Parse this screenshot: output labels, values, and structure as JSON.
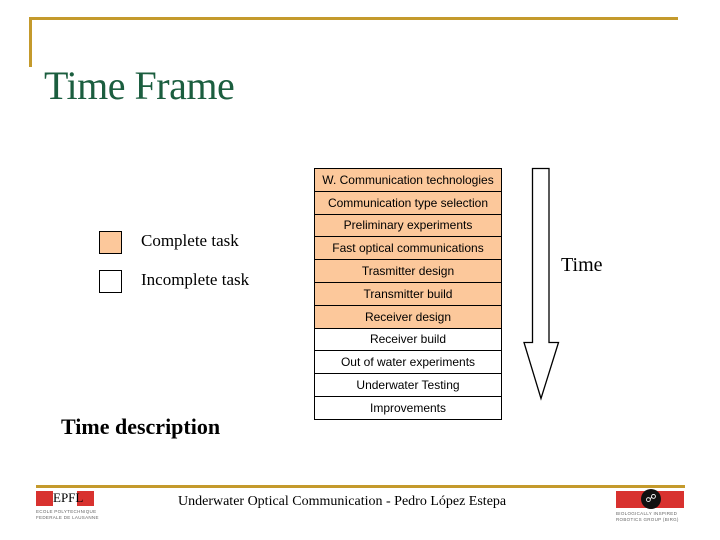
{
  "slide": {
    "title": "Time Frame",
    "accent_color": "#c49a2c",
    "title_color": "#1b5e3f"
  },
  "legend": {
    "items": [
      {
        "label": "Complete task",
        "color": "#fcc89b"
      },
      {
        "label": "Incomplete task",
        "color": "#ffffff"
      }
    ]
  },
  "tasks": [
    {
      "label": "W. Communication technologies",
      "status": "complete"
    },
    {
      "label": "Communication type selection",
      "status": "complete"
    },
    {
      "label": "Preliminary experiments",
      "status": "complete"
    },
    {
      "label": "Fast optical communications",
      "status": "complete"
    },
    {
      "label": "Trasmitter design",
      "status": "complete"
    },
    {
      "label": "Transmitter build",
      "status": "complete"
    },
    {
      "label": "Receiver design",
      "status": "complete"
    },
    {
      "label": "Receiver build",
      "status": "incomplete"
    },
    {
      "label": "Out of water experiments",
      "status": "incomplete"
    },
    {
      "label": "Underwater Testing",
      "status": "incomplete"
    },
    {
      "label": "Improvements",
      "status": "incomplete"
    }
  ],
  "arrow": {
    "label": "Time",
    "direction": "down"
  },
  "section_label": "Time description",
  "footer": {
    "text": "Underwater Optical Communication - Pedro López Estepa",
    "logo_left": {
      "mark": "EPFL",
      "line1": "ECOLE POLYTECHNIQUE",
      "line2": "FEDERALE DE LAUSANNE"
    },
    "logo_right": {
      "mark": "☍",
      "line1": "BIOLOGICALLY INSPIRED",
      "line2": "ROBOTICS GROUP (BIRG)"
    }
  }
}
